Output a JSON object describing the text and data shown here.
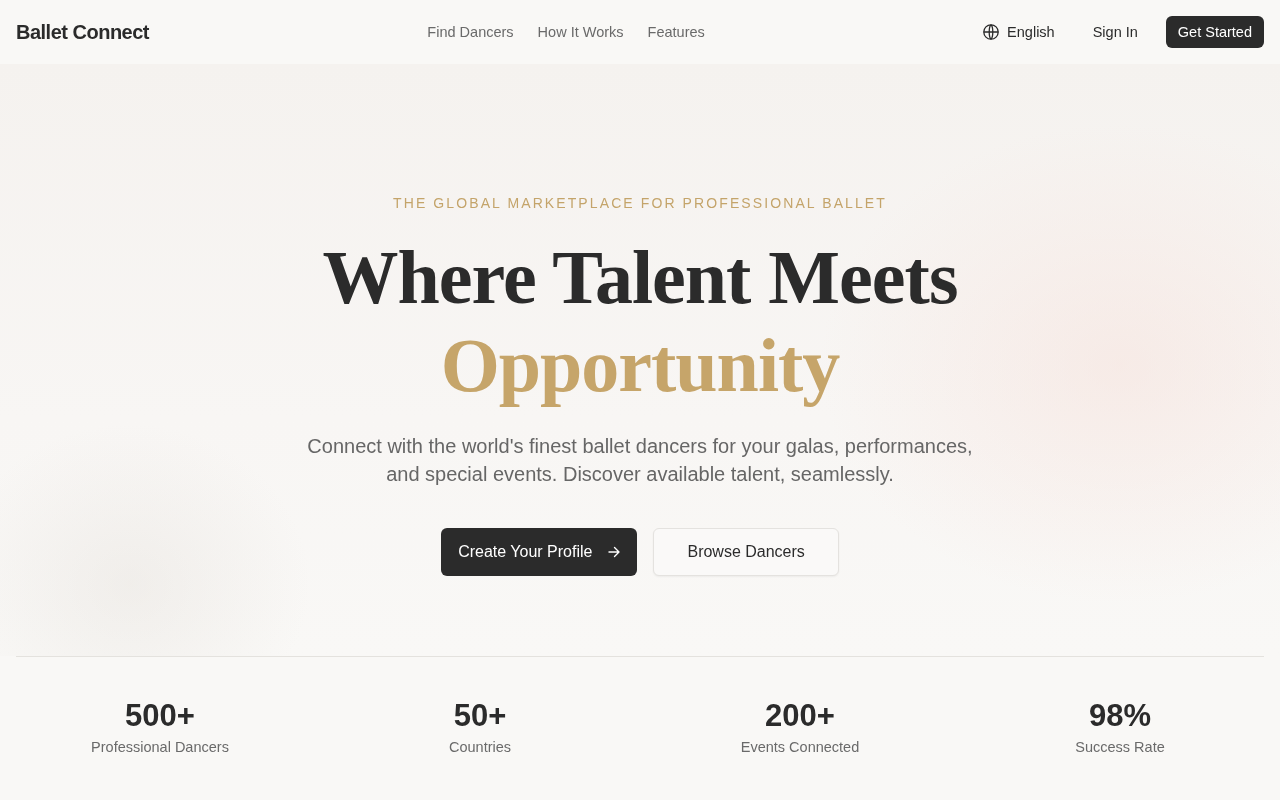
{
  "header": {
    "logo": "Ballet Connect",
    "nav": [
      {
        "label": "Find Dancers"
      },
      {
        "label": "How It Works"
      },
      {
        "label": "Features"
      }
    ],
    "language": "English",
    "sign_in": "Sign In",
    "cta": "Get Started"
  },
  "hero": {
    "eyebrow": "THE GLOBAL MARKETPLACE FOR PROFESSIONAL BALLET",
    "title": "Where Talent Meets",
    "title_highlight": "Opportunity",
    "description": "Connect with the world's finest ballet dancers for your galas, performances, and special events. Discover available talent, seamlessly.",
    "buttons": [
      {
        "label": "Create Your Profile",
        "kind": "primary"
      },
      {
        "label": "Browse Dancers",
        "kind": "secondary"
      }
    ]
  },
  "stats": [
    {
      "value": "500+",
      "label": "Professional Dancers"
    },
    {
      "value": "50+",
      "label": "Countries"
    },
    {
      "value": "200+",
      "label": "Events Connected"
    },
    {
      "value": "98%",
      "label": "Success Rate"
    }
  ]
}
